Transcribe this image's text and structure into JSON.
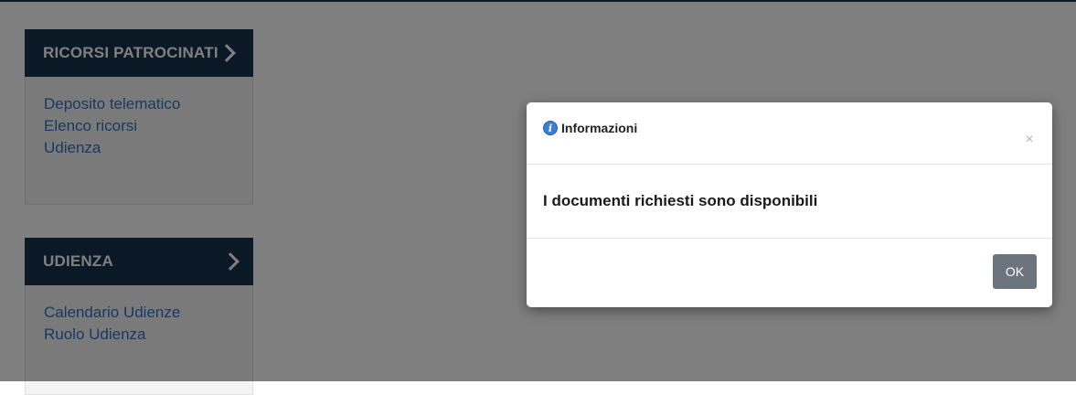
{
  "sidebar": {
    "panels": [
      {
        "title": "RICORSI PATROCINATI",
        "links": [
          "Deposito telematico",
          "Elenco ricorsi",
          "Udienza"
        ]
      },
      {
        "title": "UDIENZA",
        "links": [
          "Calendario Udienze",
          "Ruolo Udienza"
        ]
      }
    ]
  },
  "modal": {
    "title": "Informazioni",
    "info_icon_glyph": "i",
    "close_glyph": "×",
    "message": "I documenti richiesti sono disponibili",
    "ok_label": "OK"
  },
  "colors": {
    "header_navy": "#17324d",
    "link_blue": "#2f72c7",
    "ok_button_gray": "#6c757d",
    "info_icon_blue": "#3a7fd6",
    "overlay": "rgba(0,0,0,0.5)"
  },
  "icons": {
    "panel_chevron": "chevron-right-icon",
    "modal_info": "info-icon",
    "modal_close": "close-icon"
  }
}
